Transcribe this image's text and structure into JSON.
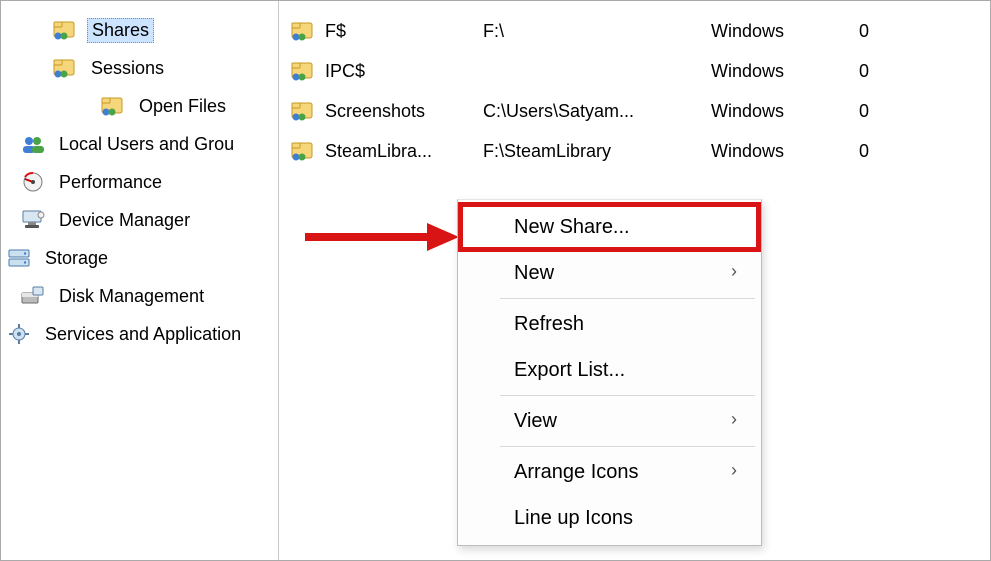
{
  "tree": {
    "shares": "Shares",
    "sessions": "Sessions",
    "open_files": "Open Files",
    "local_users": "Local Users and Grou",
    "performance": "Performance",
    "device_manager": "Device Manager",
    "storage": "Storage",
    "disk_management": "Disk Management",
    "services_apps": "Services and Application"
  },
  "list": {
    "rows": [
      {
        "name": "F$",
        "path": "F:\\",
        "type": "Windows",
        "conn": "0"
      },
      {
        "name": "IPC$",
        "path": "",
        "type": "Windows",
        "conn": "0"
      },
      {
        "name": "Screenshots",
        "path": "C:\\Users\\Satyam...",
        "type": "Windows",
        "conn": "0"
      },
      {
        "name": "SteamLibra...",
        "path": "F:\\SteamLibrary",
        "type": "Windows",
        "conn": "0"
      }
    ]
  },
  "menu": {
    "new_share": "New Share...",
    "new": "New",
    "refresh": "Refresh",
    "export_list": "Export List...",
    "view": "View",
    "arrange_icons": "Arrange Icons",
    "line_up_icons": "Line up Icons"
  }
}
